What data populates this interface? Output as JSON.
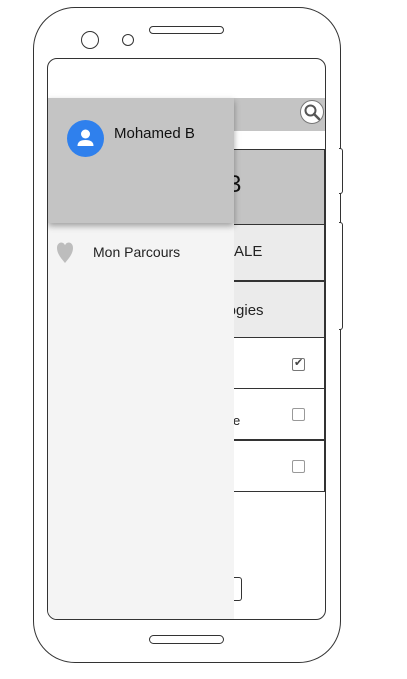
{
  "app": {
    "header_number": "3",
    "row1_text": "ALE",
    "row2_text": "ologies",
    "row_checks": [
      true,
      false,
      false
    ],
    "row2b_text": "e",
    "colon_text": ":"
  },
  "drawer": {
    "user_name": "Mohamed B",
    "menu_items": [
      {
        "label": "Mon Parcours",
        "icon": "heart-icon"
      }
    ]
  },
  "icons": {
    "search": "search-icon",
    "avatar": "person-icon"
  },
  "colors": {
    "accent": "#2f80ed",
    "header_gray": "#c4c4c4",
    "drawer_bg": "#f4f4f4"
  }
}
